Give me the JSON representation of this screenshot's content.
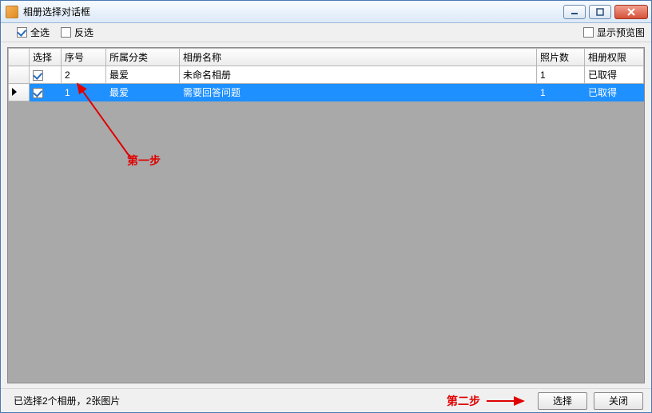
{
  "window": {
    "title": "相册选择对话框"
  },
  "toolbar": {
    "select_all": "全选",
    "invert": "反选",
    "show_preview": "显示预览图"
  },
  "grid": {
    "headers": {
      "select": "选择",
      "index": "序号",
      "category": "所属分类",
      "name": "相册名称",
      "photo_count": "照片数",
      "permission": "相册权限"
    },
    "rows": [
      {
        "checked": true,
        "index": "2",
        "category": "最爱",
        "name": "未命名相册",
        "photo_count": "1",
        "permission": "已取得",
        "selected": false,
        "current": false
      },
      {
        "checked": true,
        "index": "1",
        "category": "最爱",
        "name": "需要回答问题",
        "photo_count": "1",
        "permission": "已取得",
        "selected": true,
        "current": true
      }
    ]
  },
  "annotations": {
    "step1": "第一步",
    "step2": "第二步"
  },
  "footer": {
    "status": "已选择2个相册，2张图片",
    "select_btn": "选择",
    "close_btn": "关闭"
  },
  "colors": {
    "selection": "#1e90ff",
    "annotation": "#e00000"
  }
}
